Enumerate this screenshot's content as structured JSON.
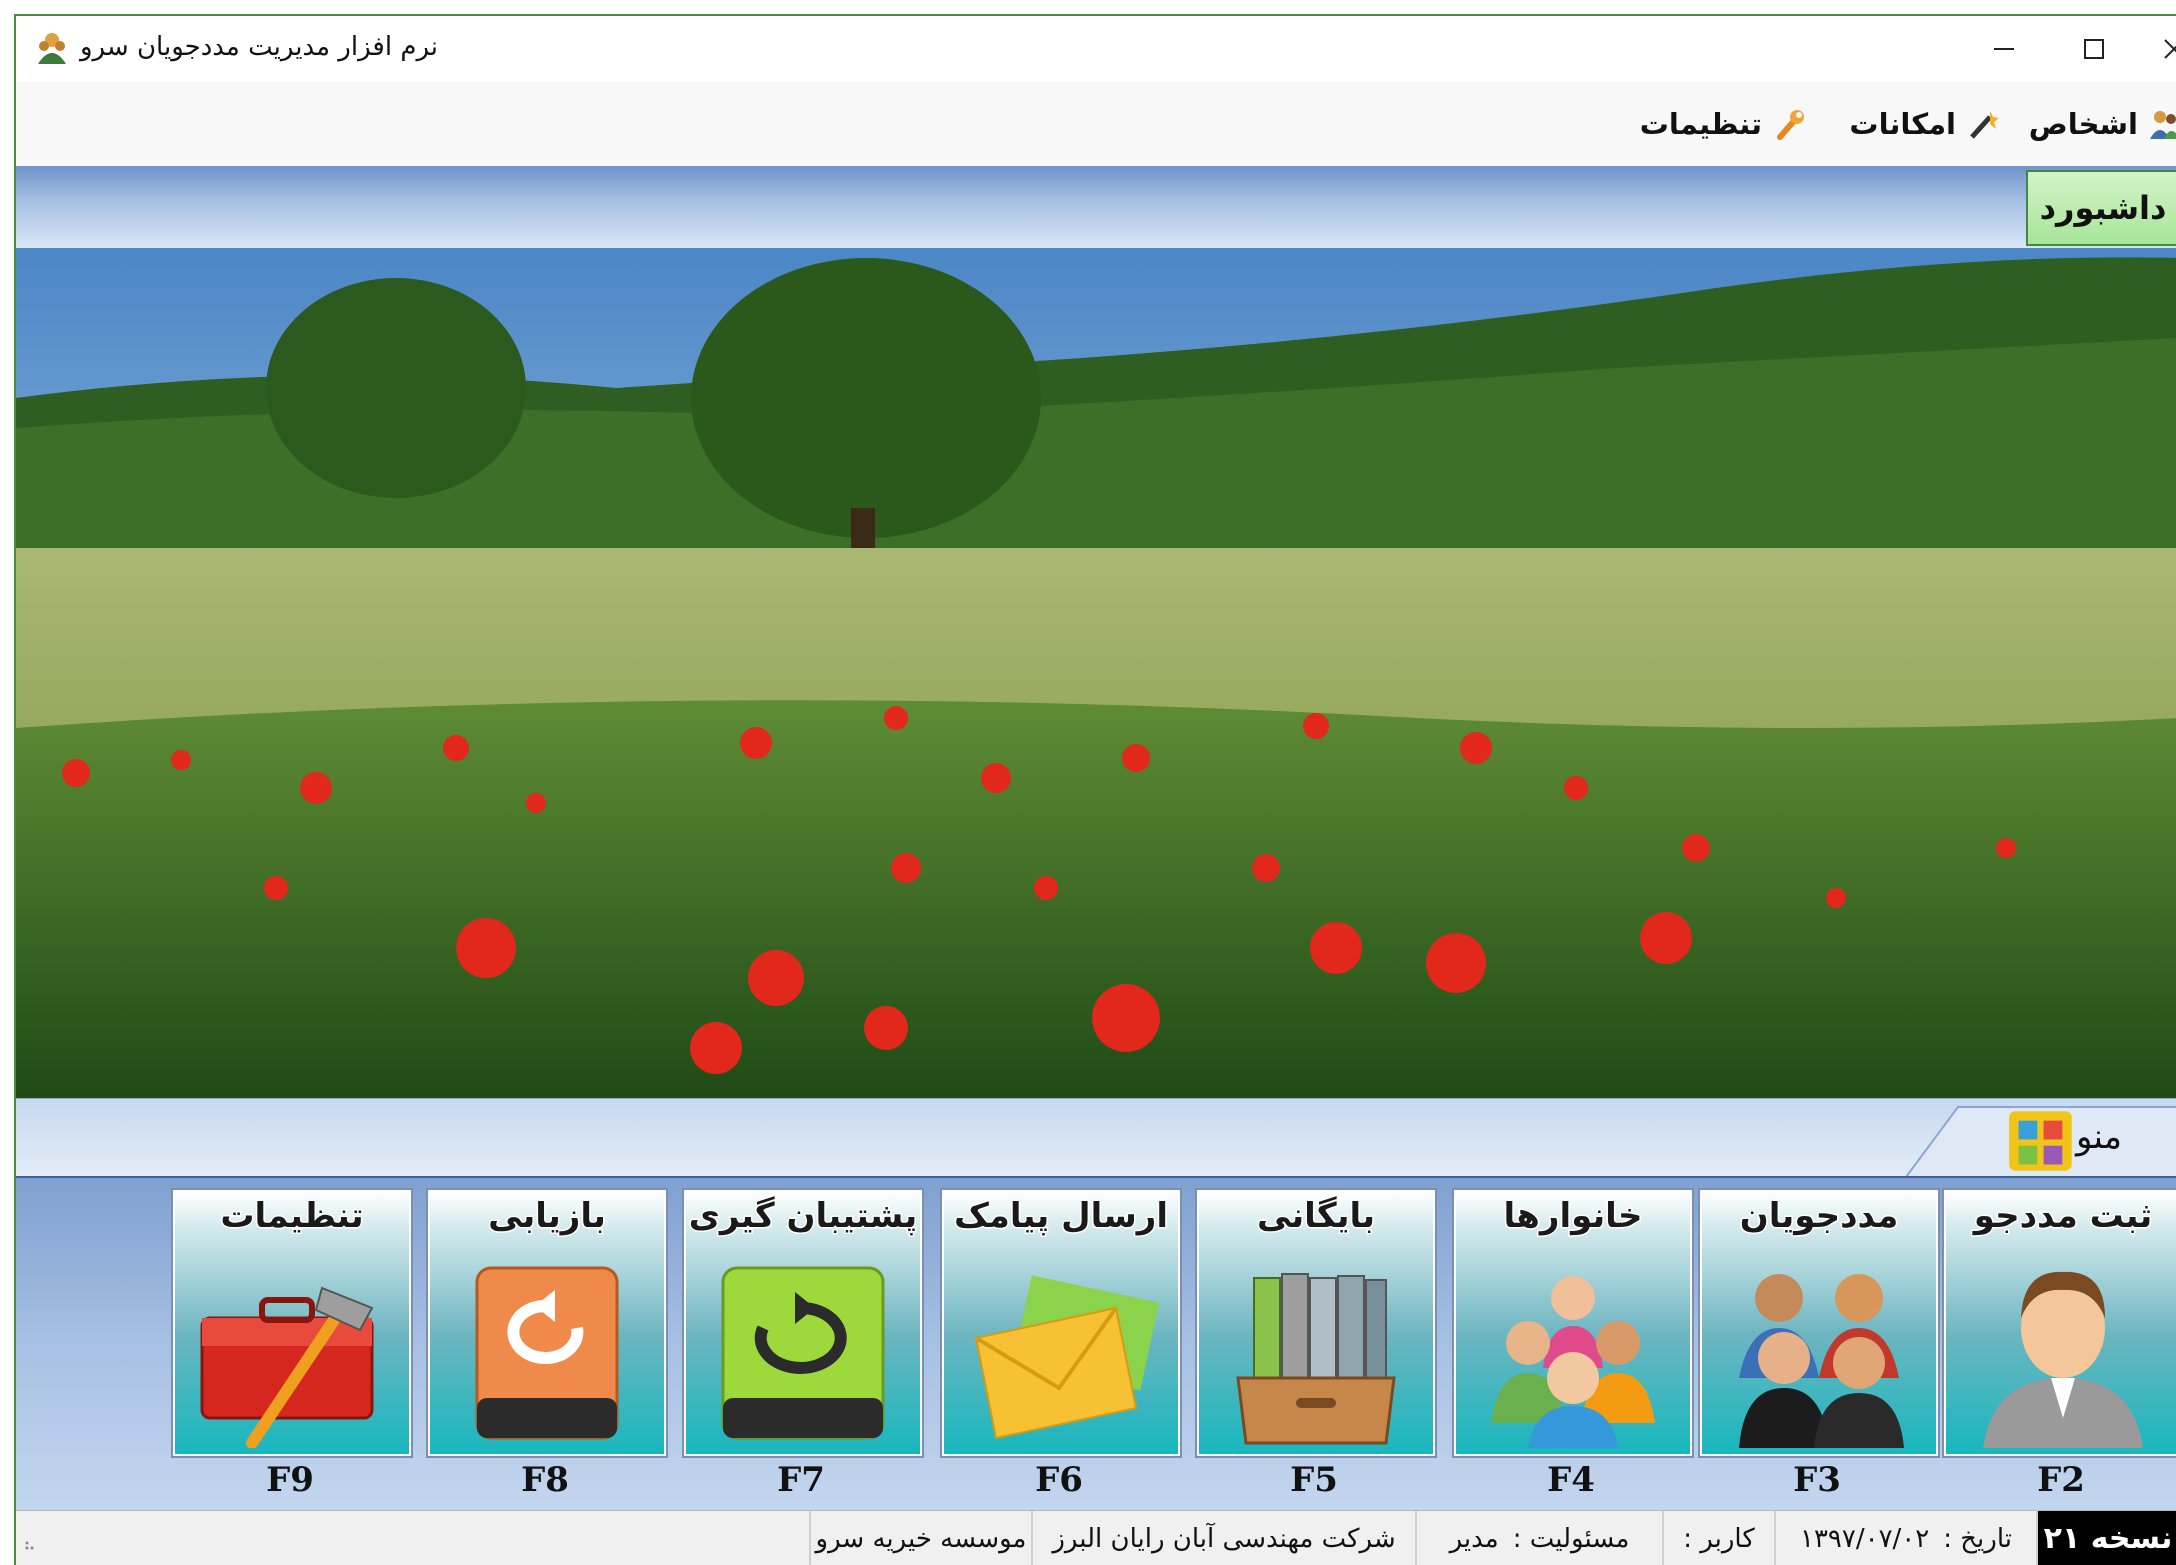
{
  "window": {
    "title": "نرم افزار مدیریت مددجویان سرو",
    "app_icon": "students-icon",
    "controls": [
      "minimize-icon",
      "maximize-icon",
      "close-icon"
    ]
  },
  "menu": {
    "items": [
      {
        "label": "اشخاص",
        "icon": "people-icon"
      },
      {
        "label": "امکانات",
        "icon": "wand-icon"
      },
      {
        "label": "تنظیمات",
        "icon": "wrench-icon"
      }
    ]
  },
  "tabs": {
    "dashboard": "داشبورد"
  },
  "menu_band": {
    "label": "منو",
    "icon": "menu-grid-icon"
  },
  "tiles": [
    {
      "label": "ثبت مددجو",
      "key": "F2",
      "icon": "user-add-icon"
    },
    {
      "label": "مددجویان",
      "key": "F3",
      "icon": "group-icon"
    },
    {
      "label": "خانوارها",
      "key": "F4",
      "icon": "family-icon"
    },
    {
      "label": "بایگانی",
      "key": "F5",
      "icon": "archive-binders-icon"
    },
    {
      "label": "ارسال پیامک",
      "key": "F6",
      "icon": "envelope-icon"
    },
    {
      "label": "پشتیبان گیری",
      "key": "F7",
      "icon": "backup-drive-icon"
    },
    {
      "label": "بازیابی",
      "key": "F8",
      "icon": "restore-drive-icon"
    },
    {
      "label": "تنظیمات",
      "key": "F9",
      "icon": "toolbox-icon"
    }
  ],
  "status": {
    "version": "نسخه ۲۱",
    "date_label": "تاریخ :",
    "date_value": "۱۳۹۷/۰۷/۰۲",
    "user_label": "کاربر :",
    "role_label": "مسئولیت :",
    "role_value": "مدیر",
    "company": "شرکت مهندسی آبان رایان البرز",
    "organization": "موسسه خیریه سرو"
  },
  "colors": {
    "tile_bottom": "#17b7be",
    "dashboard_tab": "#a8e59a",
    "panel_blue": "#7fa0cf",
    "status_version_bg": "#000000"
  }
}
